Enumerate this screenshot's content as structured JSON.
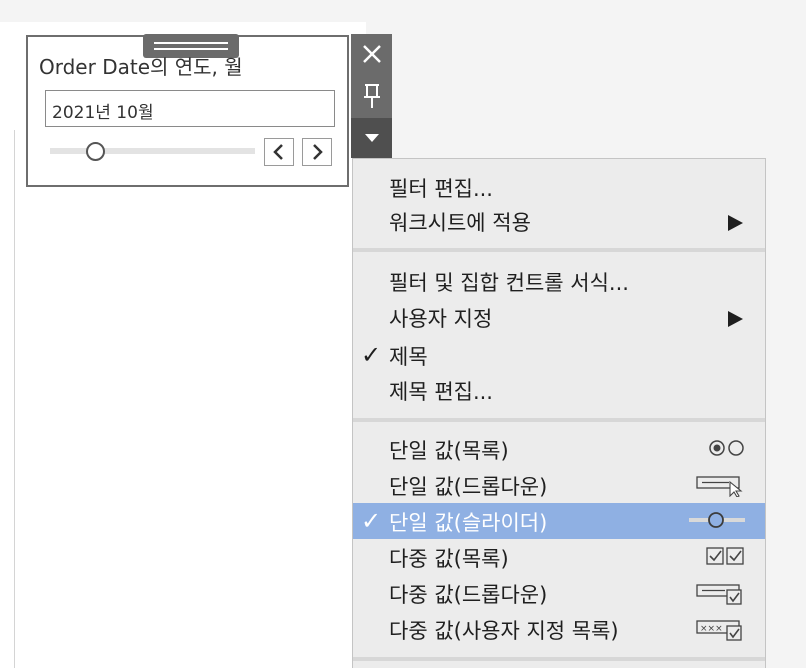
{
  "filter_card": {
    "title": "Order Date의 연도, 월",
    "value": "2021년 10월",
    "slider_level": 0.22
  },
  "menu": {
    "group1": [
      {
        "label": "필터 편집...",
        "has_submenu": false
      },
      {
        "label": "워크시트에 적용",
        "has_submenu": true
      }
    ],
    "group2": [
      {
        "label": "필터 및 집합 컨트롤 서식...",
        "checked": false,
        "has_submenu": false
      },
      {
        "label": "사용자 지정",
        "checked": false,
        "has_submenu": true
      },
      {
        "label": "제목",
        "checked": true,
        "has_submenu": false
      },
      {
        "label": "제목 편집...",
        "checked": false,
        "has_submenu": false
      }
    ],
    "group3": [
      {
        "label": "단일 값(목록)",
        "checked": false,
        "icon": "single-value-list-icon"
      },
      {
        "label": "단일 값(드롭다운)",
        "checked": false,
        "icon": "single-value-dropdown-icon"
      },
      {
        "label": "단일 값(슬라이더)",
        "checked": true,
        "icon": "single-value-slider-icon"
      },
      {
        "label": "다중 값(목록)",
        "checked": false,
        "icon": "multiple-values-list-icon"
      },
      {
        "label": "다중 값(드롭다운)",
        "checked": false,
        "icon": "multiple-values-dropdown-icon"
      },
      {
        "label": "다중 값(사용자 지정 목록)",
        "checked": false,
        "icon": "multiple-values-custom-list-icon"
      }
    ],
    "check_glyph": "✓",
    "highlight_color": "#8fb0e3"
  }
}
